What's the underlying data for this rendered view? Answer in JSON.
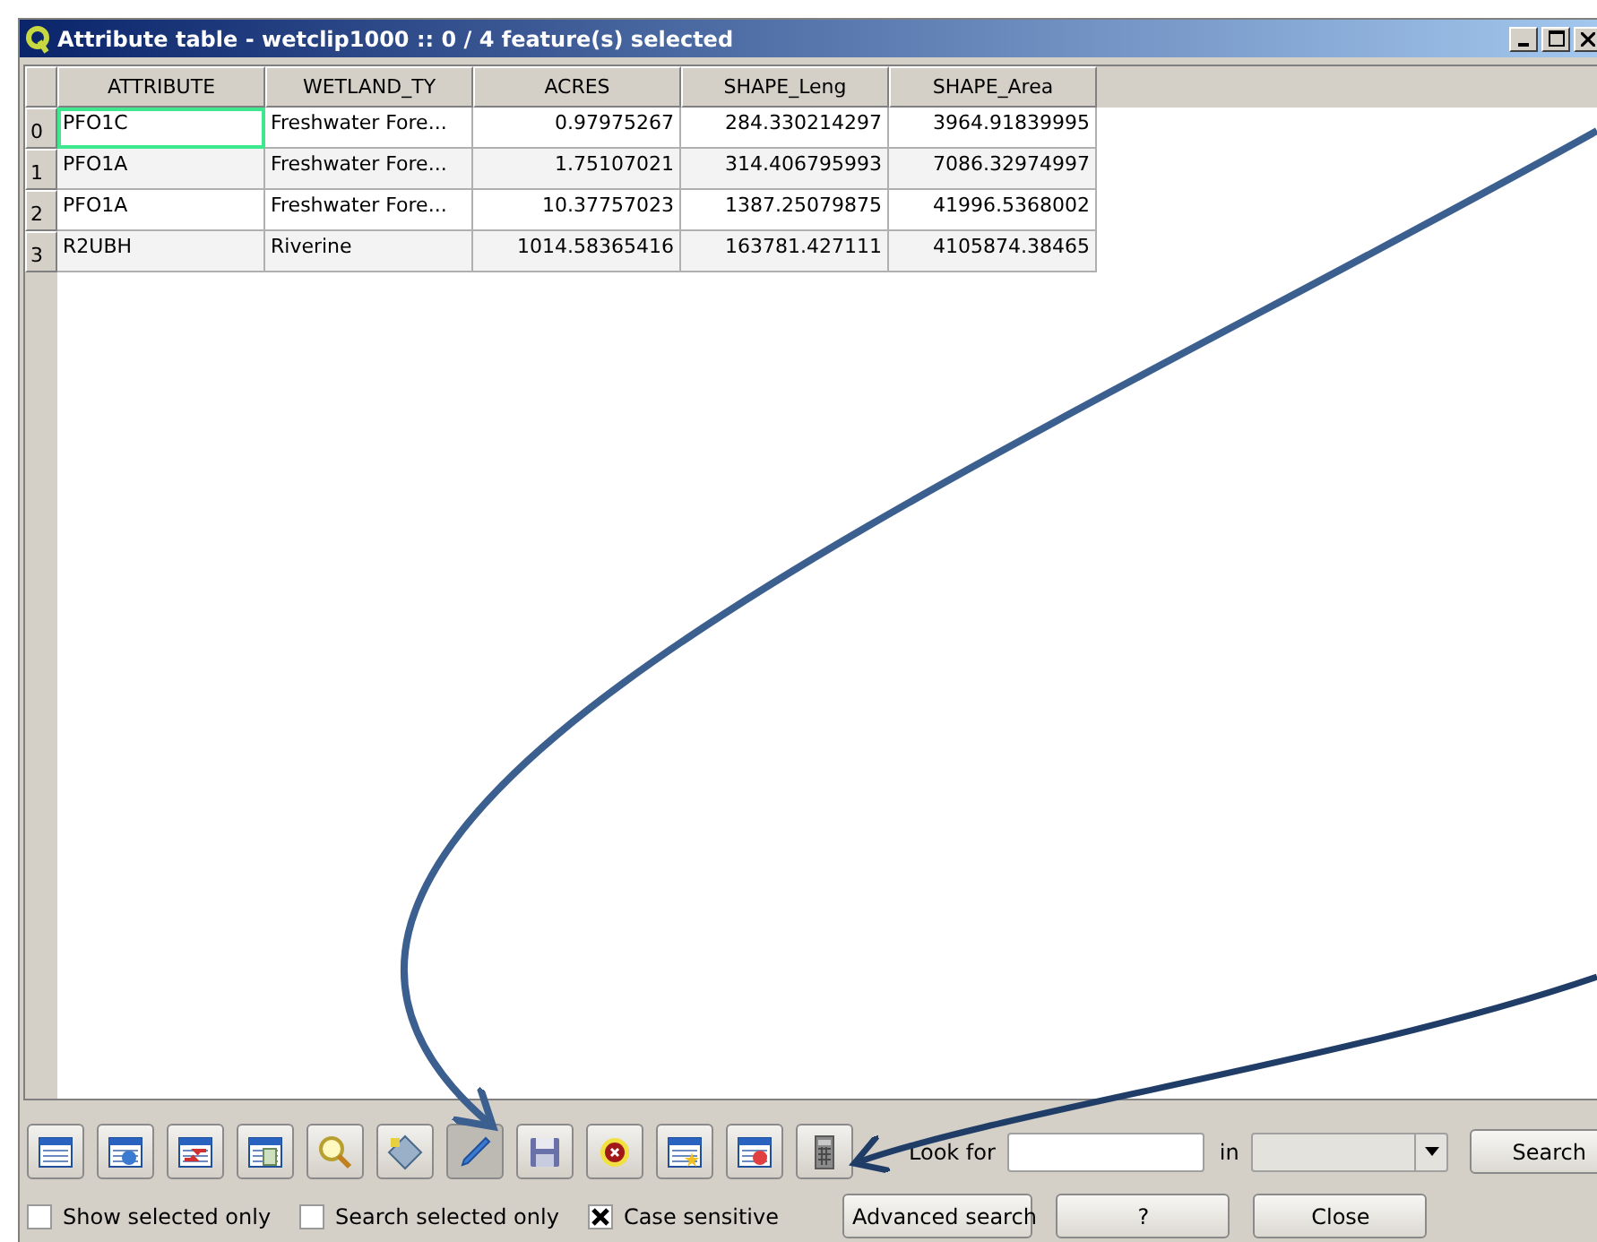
{
  "window": {
    "title": "Attribute table - wetclip1000 :: 0 / 4 feature(s) selected"
  },
  "table": {
    "columns": [
      "ATTRIBUTE",
      "WETLAND_TY",
      "ACRES",
      "SHAPE_Leng",
      "SHAPE_Area"
    ],
    "rows": [
      {
        "index": "0",
        "cells": [
          {
            "text": "PFO1C",
            "focused": true
          },
          {
            "text": "Freshwater Fore...",
            "focused": false
          },
          {
            "text": "0.97975267",
            "focused": false
          },
          {
            "text": "284.330214297",
            "focused": false
          },
          {
            "text": "3964.91839995",
            "focused": false
          }
        ]
      },
      {
        "index": "1",
        "cells": [
          {
            "text": "PFO1A",
            "focused": false
          },
          {
            "text": "Freshwater Fore...",
            "focused": false
          },
          {
            "text": "1.75107021",
            "focused": false
          },
          {
            "text": "314.406795993",
            "focused": false
          },
          {
            "text": "7086.32974997",
            "focused": false
          }
        ]
      },
      {
        "index": "2",
        "cells": [
          {
            "text": "PFO1A",
            "focused": false
          },
          {
            "text": "Freshwater Fore...",
            "focused": false
          },
          {
            "text": "10.37757023",
            "focused": false
          },
          {
            "text": "1387.25079875",
            "focused": false
          },
          {
            "text": "41996.5368002",
            "focused": false
          }
        ]
      },
      {
        "index": "3",
        "cells": [
          {
            "text": "R2UBH",
            "focused": false
          },
          {
            "text": "Riverine",
            "focused": false
          },
          {
            "text": "1014.58365416",
            "focused": false
          },
          {
            "text": "163781.427111",
            "focused": false
          },
          {
            "text": "4105874.38465",
            "focused": false
          }
        ]
      }
    ]
  },
  "toolbar": [
    {
      "kind": "table",
      "pressed": false
    },
    {
      "kind": "table-info",
      "pressed": false
    },
    {
      "kind": "table-arrows",
      "pressed": false
    },
    {
      "kind": "table-doc",
      "pressed": false
    },
    {
      "kind": "zoom",
      "pressed": false
    },
    {
      "kind": "nodes",
      "pressed": false
    },
    {
      "kind": "pencil",
      "pressed": true
    },
    {
      "kind": "save",
      "pressed": false
    },
    {
      "kind": "cancel",
      "pressed": false
    },
    {
      "kind": "table-star",
      "pressed": false
    },
    {
      "kind": "table-remove",
      "pressed": false
    },
    {
      "kind": "calculator",
      "pressed": false
    }
  ],
  "search": {
    "label": "Look for",
    "in_label": "in",
    "button": "Search"
  },
  "checkboxes": [
    {
      "label": "Show selected only",
      "checked": false
    },
    {
      "label": "Search selected only",
      "checked": false
    },
    {
      "label": "Case sensitive",
      "checked": true
    }
  ],
  "buttons": [
    "Advanced search",
    "?",
    "Close"
  ]
}
